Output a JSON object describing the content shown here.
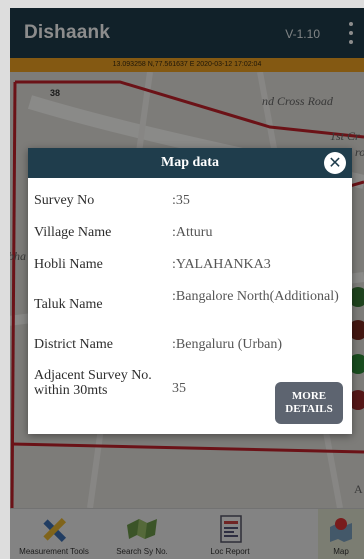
{
  "app": {
    "title": "Dishaank",
    "version": "V-1.10"
  },
  "status": {
    "text": "13.093258 N,77.561637 E  2020-03-12 17:02:04"
  },
  "map": {
    "labels": {
      "parcel": "38",
      "road": "nd Cross Road",
      "street": "1st Cr",
      "cut1": "ro",
      "cut2": "bha",
      "corner": "A"
    }
  },
  "dialog": {
    "title": "Map data",
    "close": "✕",
    "rows": [
      {
        "label": "Survey No",
        "value": ":35"
      },
      {
        "label": "Village Name",
        "value": ":Atturu"
      },
      {
        "label": "Hobli Name",
        "value": ":YALAHANKA3"
      },
      {
        "label": "Taluk Name",
        "value": ":Bangalore North(Additional)"
      },
      {
        "label": "District Name",
        "value": ":Bengaluru (Urban)"
      },
      {
        "label": "Adjacent Survey No. within 30mts",
        "value": "35"
      }
    ],
    "more_button": "MORE DETAILS"
  },
  "bottom_nav": [
    {
      "label": "Measurement Tools",
      "icon": "ruler-pencil-icon"
    },
    {
      "label": "Search Sy No.",
      "icon": "map-search-icon"
    },
    {
      "label": "Loc Report",
      "icon": "report-icon"
    },
    {
      "label": "Map",
      "icon": "map-pin-icon"
    }
  ],
  "colors": {
    "appbar": "#1f3d4c",
    "status": "#f1a322",
    "boundary": "#c4222a",
    "button": "#5d6470"
  }
}
